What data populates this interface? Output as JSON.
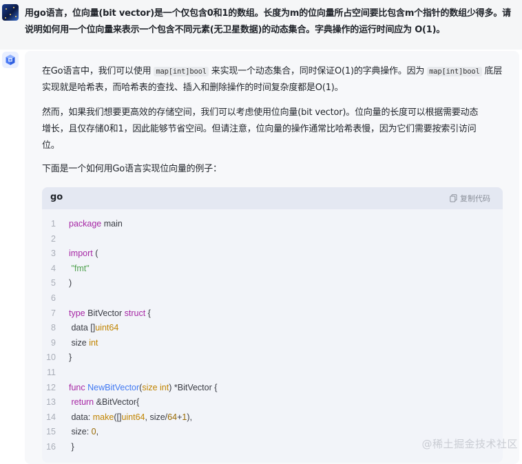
{
  "question": {
    "lines": [
      "用go语言，位向量(bit vector)是一个仅包含0和1的数组。长度为m的位向量所占空间要比包含m个指针的数组少得多。请",
      "说明如何用一个位向量来表示一个包含不同元素(无卫星数据)的动态集合。字典操作的运行时间应为 O(1)。"
    ]
  },
  "answer": {
    "p1": {
      "line1_a": "在Go语言中，我们可以使用 ",
      "code1": "map[int]bool",
      "line1_b": " 来实现一个动态集合，同时保证O(1)的字典操作。因为 ",
      "code2": "map[int]bool",
      "line1_c": " 底层",
      "line2": "实现就是哈希表，而哈希表的查找、插入和删除操作的时间复杂度都是O(1)。"
    },
    "p2": [
      "然而，如果我们想要更高效的存储空间，我们可以考虑使用位向量(bit vector)。位向量的长度可以根据需要动态",
      "增长，且仅存储0和1，因此能够节省空间。但请注意，位向量的操作通常比哈希表慢，因为它们需要按索引访问",
      "位。"
    ],
    "p3": "下面是一个如何用Go语言实现位向量的例子：",
    "code": {
      "language": "go",
      "copy_label": "复制代码",
      "line_numbers": [
        "1",
        "2",
        "3",
        "4",
        "5",
        "6",
        "7",
        "8",
        "9",
        "10",
        "11",
        "12",
        "13",
        "14",
        "15",
        "16"
      ]
    }
  },
  "watermark": "@稀土掘金技术社区"
}
